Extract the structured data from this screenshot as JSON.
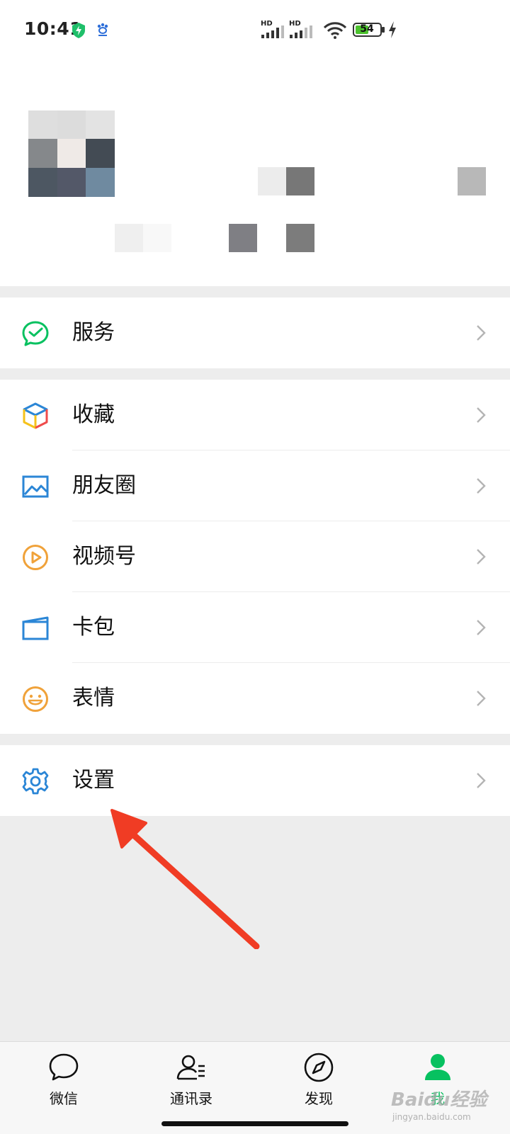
{
  "status_bar": {
    "time": "10:41",
    "signal_1": "HD",
    "signal_2": "HD",
    "battery": "54"
  },
  "menu": {
    "group1": [
      {
        "label": "服务",
        "icon": "service-icon"
      }
    ],
    "group2": [
      {
        "label": "收藏",
        "icon": "favorites-cube-icon"
      },
      {
        "label": "朋友圈",
        "icon": "moments-picture-icon"
      },
      {
        "label": "视频号",
        "icon": "channels-play-icon"
      },
      {
        "label": "卡包",
        "icon": "card-wallet-icon"
      },
      {
        "label": "表情",
        "icon": "emoji-smiley-icon"
      }
    ],
    "group3": [
      {
        "label": "设置",
        "icon": "settings-gear-icon"
      }
    ]
  },
  "tabs": [
    {
      "label": "微信",
      "icon": "chat-bubble-icon"
    },
    {
      "label": "通讯录",
      "icon": "contacts-icon"
    },
    {
      "label": "发现",
      "icon": "compass-icon"
    },
    {
      "label": "我",
      "icon": "me-person-icon",
      "active": true
    }
  ],
  "watermark": {
    "brand": "Baidu经验",
    "url": "jingyan.baidu.com"
  },
  "colors": {
    "accent_green": "#07c160",
    "arrow_red": "#f03c24",
    "blue_icon": "#2b86d6",
    "orange_icon": "#f0a23a"
  }
}
